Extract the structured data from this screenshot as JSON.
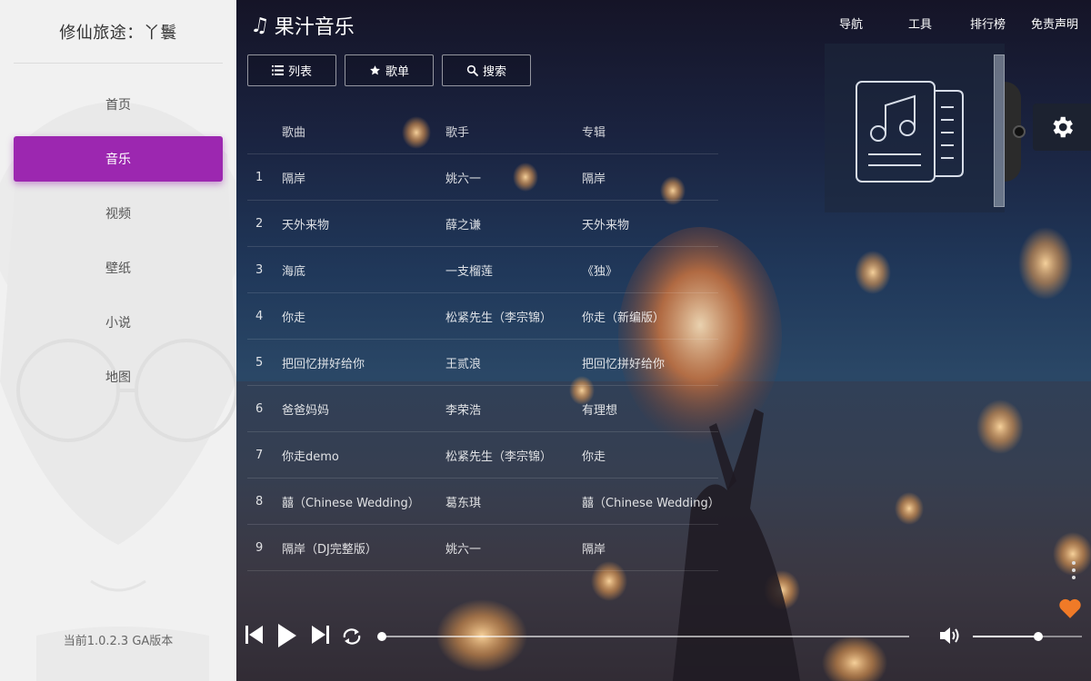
{
  "sidebar": {
    "site_title": "修仙旅途：丫鬟",
    "items": [
      {
        "label": "首页",
        "active": false
      },
      {
        "label": "音乐",
        "active": true
      },
      {
        "label": "视频",
        "active": false
      },
      {
        "label": "壁纸",
        "active": false
      },
      {
        "label": "小说",
        "active": false
      },
      {
        "label": "地图",
        "active": false
      }
    ],
    "version": "当前1.0.2.3 GA版本",
    "accent_color": "#9c27b0"
  },
  "header": {
    "brand": "果汁音乐",
    "brand_icon": "music-note-icon",
    "nav": [
      "导航",
      "工具",
      "排行榜",
      "免责声明"
    ]
  },
  "tabs": [
    {
      "label": "列表",
      "icon": "list-icon"
    },
    {
      "label": "歌单",
      "icon": "star-icon"
    },
    {
      "label": "搜索",
      "icon": "search-icon"
    }
  ],
  "song_list": {
    "headers": {
      "title": "歌曲",
      "artist": "歌手",
      "album": "专辑"
    },
    "rows": [
      {
        "index": "1",
        "title": "隔岸",
        "artist": "姚六一",
        "album": "隔岸"
      },
      {
        "index": "2",
        "title": "天外来物",
        "artist": "薛之谦",
        "album": "天外来物"
      },
      {
        "index": "3",
        "title": "海底",
        "artist": "一支榴莲",
        "album": "《独》"
      },
      {
        "index": "4",
        "title": "你走",
        "artist": "松紧先生（李宗锦）",
        "album": "你走（新编版）"
      },
      {
        "index": "5",
        "title": "把回忆拼好给你",
        "artist": "王贰浪",
        "album": "把回忆拼好给你"
      },
      {
        "index": "6",
        "title": "爸爸妈妈",
        "artist": "李荣浩",
        "album": "有理想"
      },
      {
        "index": "7",
        "title": "你走demo",
        "artist": "松紧先生（李宗锦）",
        "album": "你走"
      },
      {
        "index": "8",
        "title": "囍（Chinese Wedding）",
        "artist": "葛东琪",
        "album": "囍（Chinese Wedding）"
      },
      {
        "index": "9",
        "title": "隔岸（DJ完整版）",
        "artist": "姚六一",
        "album": "隔岸"
      }
    ]
  },
  "player": {
    "progress": 0.0,
    "volume": 0.6,
    "heart_color": "#f07a27"
  }
}
